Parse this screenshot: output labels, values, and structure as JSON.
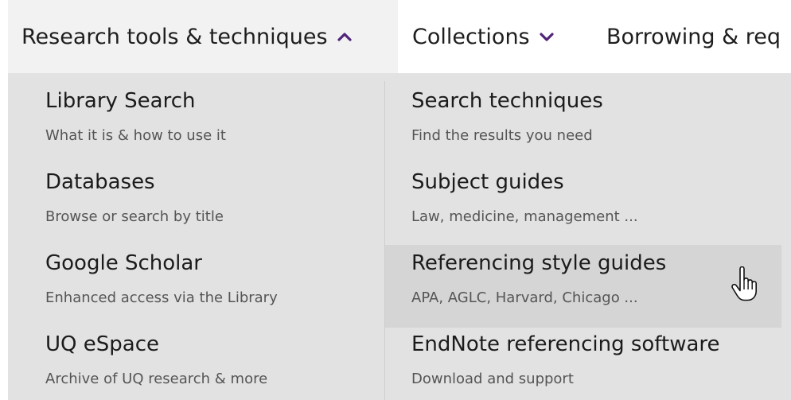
{
  "nav": {
    "items": [
      {
        "label": "Research tools & techniques",
        "chevron": "chevron-up-icon",
        "active": true
      },
      {
        "label": "Collections",
        "chevron": "chevron-down-icon",
        "active": false
      },
      {
        "label": "Borrowing & req",
        "active": false
      }
    ],
    "chevron_color": "#51247a"
  },
  "dropdown": {
    "left_column": [
      {
        "title": "Library Search",
        "subtitle": "What it is & how to use it"
      },
      {
        "title": "Databases",
        "subtitle": "Browse or search by title"
      },
      {
        "title": "Google Scholar",
        "subtitle": "Enhanced access via the Library"
      },
      {
        "title": "UQ eSpace",
        "subtitle": "Archive of UQ research & more"
      }
    ],
    "right_column": [
      {
        "title": "Search techniques",
        "subtitle": "Find the results you need"
      },
      {
        "title": "Subject guides",
        "subtitle": "Law, medicine, management ..."
      },
      {
        "title": "Referencing style guides",
        "subtitle": "APA, AGLC, Harvard, Chicago ...",
        "hovered": true
      },
      {
        "title": "EndNote referencing software",
        "subtitle": "Download and support"
      }
    ]
  },
  "cursor": "hand-pointer-icon"
}
